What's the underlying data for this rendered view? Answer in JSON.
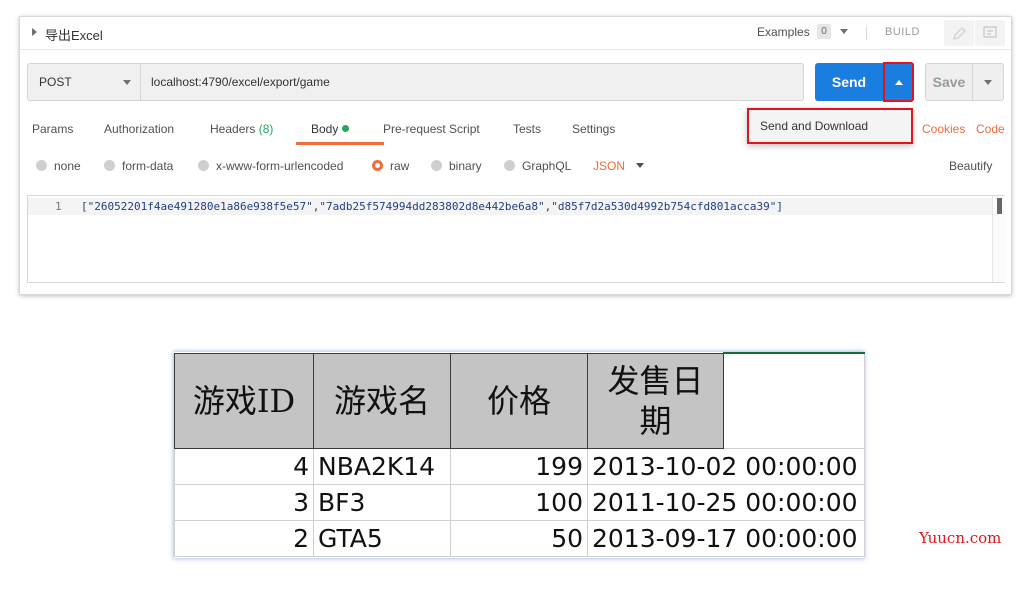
{
  "request": {
    "title": "导出Excel",
    "examples_label": "Examples",
    "examples_count": "0",
    "build_label": "BUILD",
    "method": "POST",
    "url": "localhost:4790/excel/export/game",
    "send_label": "Send",
    "save_label": "Save",
    "dropdown_item": "Send and Download"
  },
  "tabs": {
    "params": "Params",
    "authorization": "Authorization",
    "headers": "Headers",
    "headers_count": "(8)",
    "body": "Body",
    "prerequest": "Pre-request Script",
    "tests": "Tests",
    "settings": "Settings",
    "cookies": "Cookies",
    "code": "Code"
  },
  "body_modes": {
    "none": "none",
    "form_data": "form-data",
    "urlencoded": "x-www-form-urlencoded",
    "raw": "raw",
    "binary": "binary",
    "graphql": "GraphQL",
    "format": "JSON",
    "beautify": "Beautify"
  },
  "editor": {
    "line_number": "1",
    "code": "[\"26052201f4ae491280e1a86e938f5e57\",\"7adb25f574994dd283802d8e442be6a8\",\"d85f7d2a530d4992b754cfd801acca39\"]"
  },
  "sheet": {
    "headers": [
      "游戏ID",
      "游戏名",
      "价格",
      "发售日期"
    ],
    "rows": [
      {
        "id": "4",
        "name": "NBA2K14",
        "price": "199",
        "date": "2013-10-02 00:00:00"
      },
      {
        "id": "3",
        "name": "BF3",
        "price": "100",
        "date": "2011-10-25 00:00:00"
      },
      {
        "id": "2",
        "name": "GTA5",
        "price": "50",
        "date": "2013-09-17 00:00:00"
      }
    ]
  },
  "watermark": "Yuucn.com",
  "colors": {
    "send_blue": "#1a7de0",
    "accent_orange": "#f26b3a",
    "highlight_red": "#e0141c",
    "header_gray": "#c4c4c4"
  }
}
